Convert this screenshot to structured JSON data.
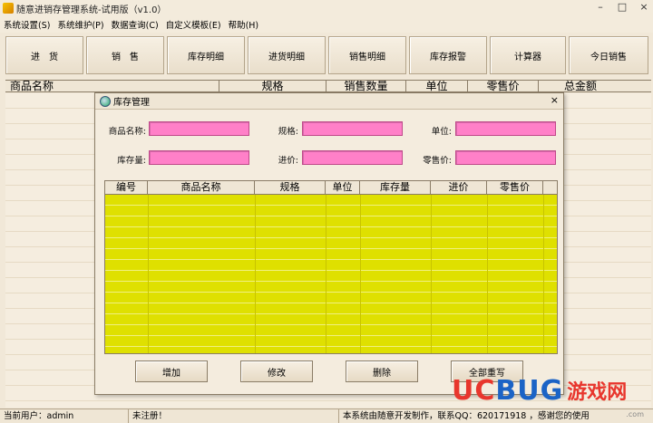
{
  "window": {
    "title": "随意进销存管理系统-试用版（v1.0）",
    "controls": [
      "–",
      "□",
      "×"
    ]
  },
  "menu": [
    {
      "label": "系统设置(S)"
    },
    {
      "label": "系统维护(P)"
    },
    {
      "label": "数据查询(C)"
    },
    {
      "label": "自定义模板(E)"
    },
    {
      "label": "帮助(H)"
    }
  ],
  "toolbar": [
    {
      "label": "进　货"
    },
    {
      "label": "销　售"
    },
    {
      "label": "库存明细"
    },
    {
      "label": "进货明细"
    },
    {
      "label": "销售明细"
    },
    {
      "label": "库存报警"
    },
    {
      "label": "计算器"
    },
    {
      "label": "今日销售"
    }
  ],
  "main_table": {
    "columns": [
      "商品名称",
      "规格",
      "销售数量",
      "单位",
      "零售价",
      "总金额"
    ]
  },
  "dialog": {
    "title": "库存管理",
    "close": "×",
    "fields": {
      "name_label": "商品名称:",
      "spec_label": "规格:",
      "unit_label": "单位:",
      "stock_label": "库存量:",
      "cost_label": "进价:",
      "price_label": "零售价:",
      "name_value": "",
      "spec_value": "",
      "unit_value": "",
      "stock_value": "",
      "cost_value": "",
      "price_value": ""
    },
    "grid_columns": [
      "编号",
      "商品名称",
      "规格",
      "单位",
      "库存量",
      "进价",
      "零售价"
    ],
    "buttons": {
      "add": "增加",
      "edit": "修改",
      "delete": "删除",
      "reset": "全部重写"
    },
    "colors": {
      "input_bg": "#ff80c8",
      "grid_bg": "#dfe000"
    }
  },
  "status": {
    "user": "当前用户：admin",
    "reg": "未注册！",
    "info": "本系统由随意开发制作，联系QQ：620171918 ，感谢您的使用"
  },
  "watermark": {
    "logo_uc": "UC",
    "logo_bug": "BUG",
    "logo_cn": "游戏网",
    "url": ".com"
  }
}
